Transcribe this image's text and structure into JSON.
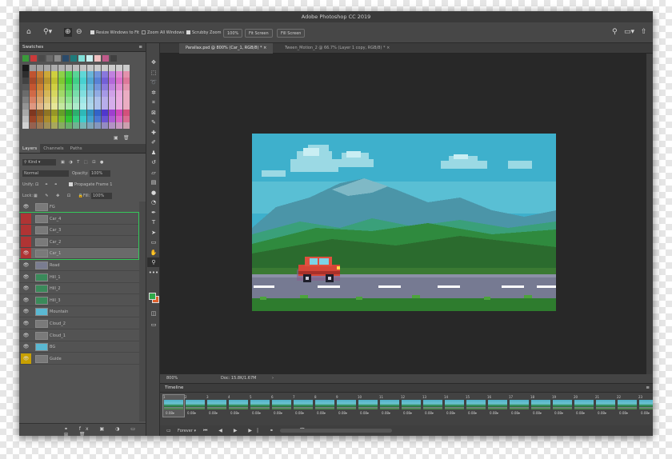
{
  "app": {
    "title": "Adobe Photoshop CC 2019"
  },
  "options_bar": {
    "resize_windows": "Resize Windows to Fit",
    "zoom_all_windows": "Zoom All Windows",
    "scrubby_zoom": "Scrubby Zoom",
    "zoom_100": "100%",
    "fit_screen": "Fit Screen",
    "fill_screen": "Fill Screen"
  },
  "doc_tabs": [
    {
      "label": "Parallax.psd @ 800% (Car_1, RGB/8) *",
      "active": true
    },
    {
      "label": "Tween_Motion_2 @ 66.7% (Layer 1 copy, RGB/8) *",
      "active": false
    }
  ],
  "swatches": {
    "title": "Swatches"
  },
  "layers_panel": {
    "tabs": [
      "Layers",
      "Channels",
      "Paths"
    ],
    "kind": "Kind",
    "blend_mode": "Normal",
    "opacity_label": "Opacity:",
    "opacity_value": "100%",
    "unify_label": "Unify:",
    "propagate_label": "Propagate Frame 1",
    "lock_label": "Lock:",
    "fill_label": "Fill:",
    "fill_value": "100%",
    "layers": [
      {
        "name": "FG",
        "eye": true
      },
      {
        "name": "Car_4",
        "eye": false
      },
      {
        "name": "Car_3",
        "eye": false
      },
      {
        "name": "Car_2",
        "eye": false
      },
      {
        "name": "Car_1",
        "eye": true
      },
      {
        "name": "Road",
        "eye": true
      },
      {
        "name": "Hill_1",
        "eye": true
      },
      {
        "name": "Hill_2",
        "eye": true
      },
      {
        "name": "Hill_3",
        "eye": true
      },
      {
        "name": "Mountain",
        "eye": true
      },
      {
        "name": "Cloud_2",
        "eye": true
      },
      {
        "name": "Cloud_1",
        "eye": true
      },
      {
        "name": "BG",
        "eye": true
      },
      {
        "name": "Guide",
        "eye": true
      }
    ]
  },
  "status": {
    "zoom": "800%",
    "doc": "Doc: 15.8K/1.67M"
  },
  "timeline": {
    "title": "Timeline",
    "loop": "Forever",
    "frames": [
      "1",
      "2",
      "3",
      "4",
      "5",
      "6",
      "7",
      "8",
      "9",
      "10",
      "11",
      "12",
      "13",
      "14",
      "15",
      "16",
      "17",
      "18",
      "19",
      "20",
      "21",
      "22",
      "23",
      "24"
    ],
    "delay": "0.08▾"
  },
  "colors": {
    "accent_green": "#35c85a",
    "layer_red": "#b03434",
    "guide_yellow": "#c8a000",
    "foreground_color": "#2fa84a",
    "background_color": "#e0602c"
  }
}
